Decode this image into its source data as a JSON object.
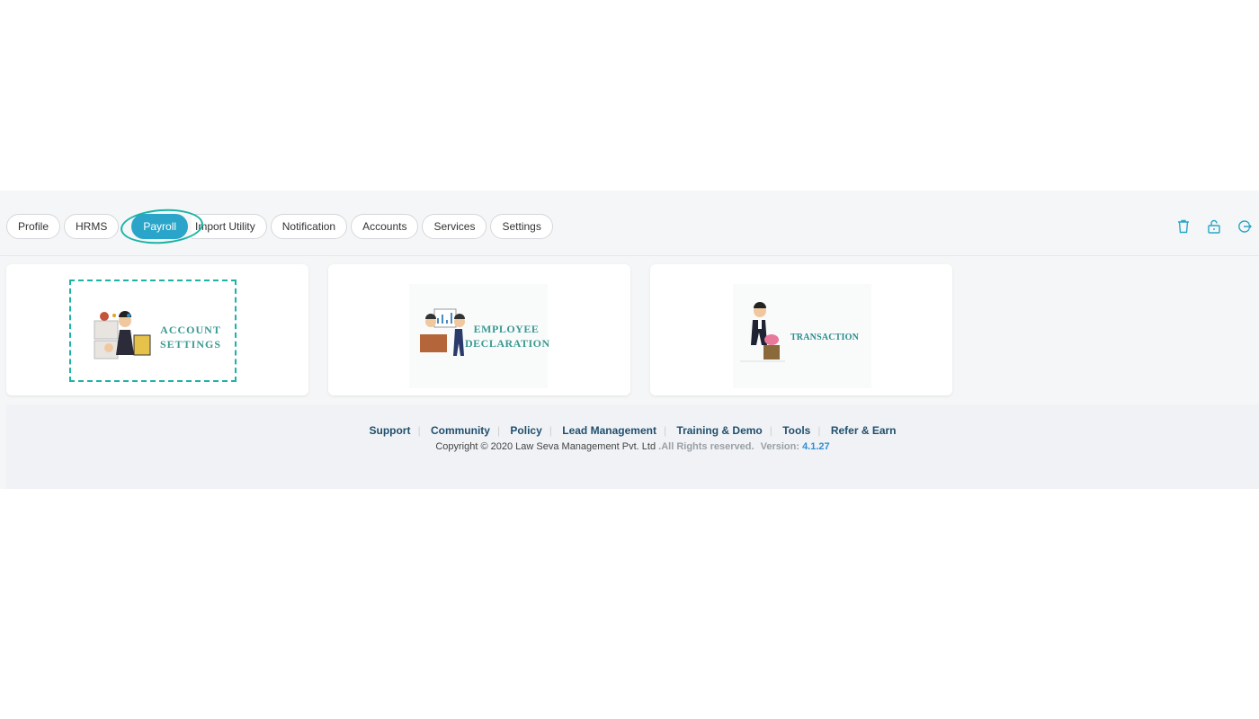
{
  "nav": {
    "tabs": [
      {
        "label": "Profile"
      },
      {
        "label": "HRMS"
      },
      {
        "label": "Payroll"
      },
      {
        "label": "Import Utility"
      },
      {
        "label": "Notification"
      },
      {
        "label": "Accounts"
      },
      {
        "label": "Services"
      },
      {
        "label": "Settings"
      }
    ],
    "active_tab": "Payroll",
    "icons": [
      "trash-icon",
      "unlock-icon",
      "logout-icon"
    ]
  },
  "cards": [
    {
      "title_line1": "ACCOUNT",
      "title_line2": "SETTINGS"
    },
    {
      "title_line1": "EMPLOYEE",
      "title_line2": "DECLARATION"
    },
    {
      "title_line1": "TRANSACTION"
    }
  ],
  "footer": {
    "links": {
      "support": "Support",
      "community": "Community",
      "policy": "Policy",
      "lead_management": "Lead Management",
      "training_demo": "Training & Demo",
      "tools": "Tools",
      "refer_earn": "Refer & Earn"
    },
    "copyright": "Copyright © 2020 Law Seva Management Pvt. Ltd",
    "rights": ".All Rights reserved.",
    "version_label": "Version:",
    "version": "4.1.27"
  },
  "colors": {
    "accent": "#2aa5c9",
    "highlight": "#1ab3a6",
    "link": "#1f4f6e",
    "version": "#2d8fd5"
  }
}
